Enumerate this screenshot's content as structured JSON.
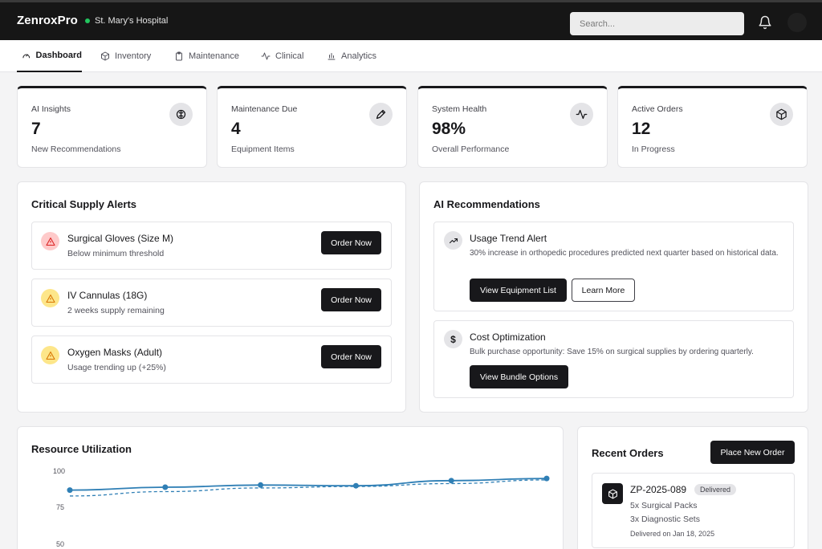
{
  "header": {
    "brand": "ZenroxPro",
    "hospital": "St. Mary's Hospital",
    "search_placeholder": "Search...",
    "bell_icon": "bell-icon",
    "accent_green": "#22c55e"
  },
  "nav": {
    "tabs": [
      {
        "label": "Dashboard",
        "icon": "gauge-icon",
        "active": true
      },
      {
        "label": "Inventory",
        "icon": "box-icon"
      },
      {
        "label": "Maintenance",
        "icon": "clipboard-icon"
      },
      {
        "label": "Clinical",
        "icon": "activity-icon"
      },
      {
        "label": "Analytics",
        "icon": "bar-chart-icon"
      }
    ]
  },
  "stats": [
    {
      "label": "AI Insights",
      "value": "7",
      "sub": "New Recommendations",
      "icon": "brain-icon"
    },
    {
      "label": "Maintenance Due",
      "value": "4",
      "sub": "Equipment Items",
      "icon": "tool-icon"
    },
    {
      "label": "System Health",
      "value": "98%",
      "sub": "Overall Performance",
      "icon": "activity-icon"
    },
    {
      "label": "Active Orders",
      "value": "12",
      "sub": "In Progress",
      "icon": "package-icon"
    }
  ],
  "alerts": {
    "title": "Critical Supply Alerts",
    "items": [
      {
        "name": "Surgical Gloves (Size M)",
        "status": "Below minimum threshold",
        "button": "Order Now",
        "severity": "critical",
        "color": "#fecaca"
      },
      {
        "name": "IV Cannulas (18G)",
        "status": "2 weeks supply remaining",
        "button": "Order Now",
        "severity": "warning",
        "color": "#fde68a"
      },
      {
        "name": "Oxygen Masks (Adult)",
        "status": "Usage trending up (+25%)",
        "button": "Order Now",
        "severity": "warning",
        "color": "#fde68a"
      }
    ]
  },
  "recommendations": {
    "title": "AI Recommendations",
    "items": [
      {
        "title": "Usage Trend Alert",
        "desc": "30% increase in orthopedic procedures predicted next quarter based on historical data.",
        "icon": "trending-up-icon",
        "primary": "View Equipment List",
        "secondary": "Learn More"
      },
      {
        "title": "Cost Optimization",
        "desc": "Bulk purchase opportunity: Save 15% on surgical supplies by ordering quarterly.",
        "icon": "dollar-icon",
        "primary": "View Bundle Options"
      }
    ]
  },
  "utilization": {
    "title": "Resource Utilization",
    "chart_data": {
      "type": "line",
      "x": [
        1,
        2,
        3,
        4,
        5,
        6
      ],
      "ylim": [
        50,
        100
      ],
      "yticks": [
        "100",
        "75",
        "50"
      ],
      "series": [
        {
          "values": [
            87,
            89,
            90.5,
            90,
            93.5,
            95
          ],
          "style": "solid",
          "color": "#2f7fb5"
        },
        {
          "values": [
            83,
            86,
            88.5,
            89.5,
            91.5,
            94
          ],
          "style": "dashed",
          "color": "#2f7fb5"
        }
      ]
    }
  },
  "orders": {
    "title": "Recent Orders",
    "new_button": "Place New Order",
    "items": [
      {
        "id": "ZP-2025-089",
        "status": "Delivered",
        "line1": "5x Surgical Packs",
        "line2": "3x Diagnostic Sets",
        "date": "Delivered on Jan 18, 2025"
      }
    ]
  }
}
